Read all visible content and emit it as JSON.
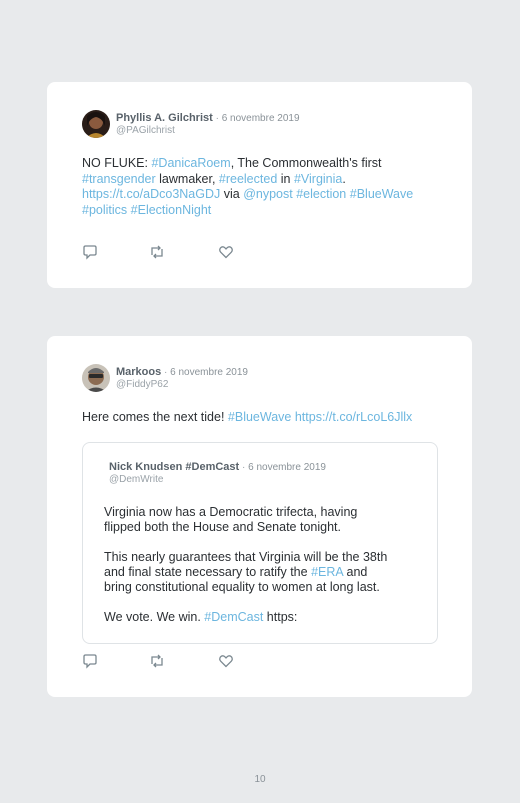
{
  "tweets": [
    {
      "author": "Phyllis A. Gilchrist",
      "date": "6 novembre 2019",
      "handle": "@PAGilchrist",
      "text": {
        "p1": "NO FLUKE: ",
        "h1": "#DanicaRoem",
        "p2": ", The Commonwealth's first",
        "h2": "#transgender",
        "p3": " lawmaker, ",
        "h3": "#reelected",
        "p4": " in ",
        "h4": "#Virginia",
        "p5": ".",
        "url": "https://t.co/aDco3NaGDJ",
        "p6": " via ",
        "mention": "@nypost",
        "h5": "#election",
        "h6": "#BlueWave",
        "h7": "#politics",
        "h8": "#ElectionNight"
      }
    },
    {
      "author": "Markoos",
      "date": "6 novembre 2019",
      "handle": "@FiddyP62",
      "text": {
        "p1": "Here comes the next tide! ",
        "h1": "#BlueWave",
        "url": "https://t.co/rLcoL6Jllx"
      },
      "quote": {
        "author": "Nick Knudsen #DemCast",
        "date": "6 novembre 2019",
        "handle": "@DemWrite",
        "para1_l1": "Virginia now has a Democratic trifecta, having",
        "para1_l2": "flipped both the House and Senate tonight.",
        "para2_l1": "This nearly guarantees that Virginia will be the 38th",
        "para2_l2a": "and final state necessary to ratify the ",
        "para2_h": "#ERA",
        "para2_l2b": " and",
        "para2_l3": "bring constitutional equality to women at long last.",
        "para3_a": "We vote. We win. ",
        "para3_h": "#DemCast",
        "para3_b": " https:"
      }
    }
  ],
  "separator": "·",
  "page_number": "10",
  "icons": [
    "reply-icon",
    "retweet-icon",
    "like-icon"
  ],
  "colors": {
    "link": "#6cb6df",
    "background": "#e8eaec",
    "card": "#ffffff"
  }
}
